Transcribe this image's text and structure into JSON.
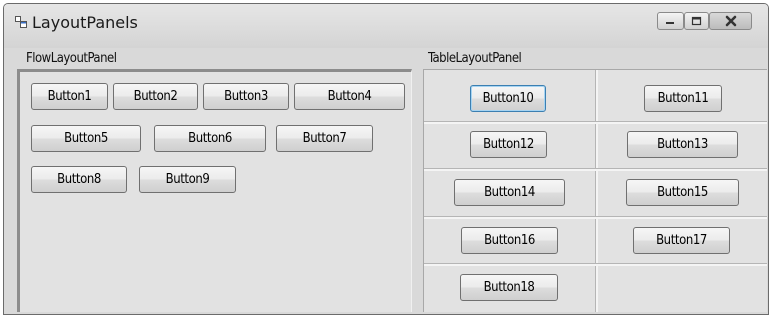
{
  "window": {
    "title": "LayoutPanels",
    "icon": "app-window-icon",
    "controls": [
      "minimize-icon",
      "maximize-icon",
      "close-icon"
    ]
  },
  "flow_panel": {
    "label": "FlowLayoutPanel",
    "buttons": [
      "Button1",
      "Button2",
      "Button3",
      "Button4",
      "Button5",
      "Button6",
      "Button7",
      "Button8",
      "Button9"
    ]
  },
  "table_panel": {
    "label": "TableLayoutPanel",
    "buttons": [
      "Button10",
      "Button11",
      "Button12",
      "Button13",
      "Button14",
      "Button15",
      "Button16",
      "Button17",
      "Button18"
    ]
  }
}
